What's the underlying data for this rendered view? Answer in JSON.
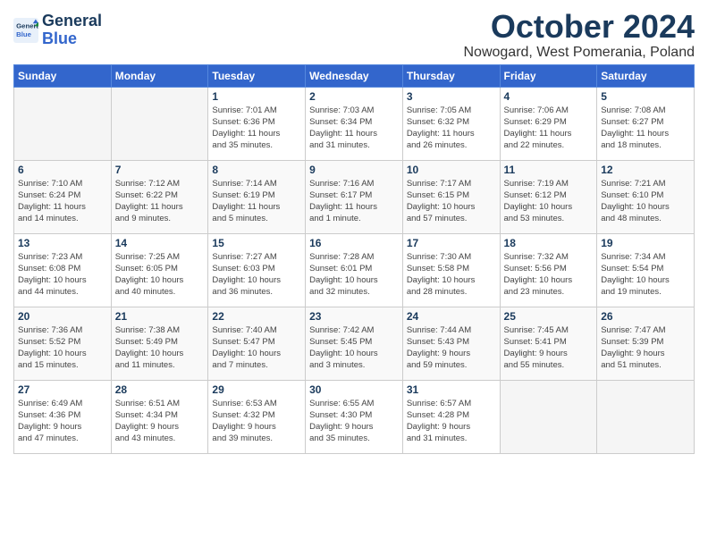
{
  "logo": {
    "line1": "General",
    "line2": "Blue"
  },
  "title": "October 2024",
  "location": "Nowogard, West Pomerania, Poland",
  "days_of_week": [
    "Sunday",
    "Monday",
    "Tuesday",
    "Wednesday",
    "Thursday",
    "Friday",
    "Saturday"
  ],
  "weeks": [
    [
      {
        "day": "",
        "info": ""
      },
      {
        "day": "",
        "info": ""
      },
      {
        "day": "1",
        "info": "Sunrise: 7:01 AM\nSunset: 6:36 PM\nDaylight: 11 hours\nand 35 minutes."
      },
      {
        "day": "2",
        "info": "Sunrise: 7:03 AM\nSunset: 6:34 PM\nDaylight: 11 hours\nand 31 minutes."
      },
      {
        "day": "3",
        "info": "Sunrise: 7:05 AM\nSunset: 6:32 PM\nDaylight: 11 hours\nand 26 minutes."
      },
      {
        "day": "4",
        "info": "Sunrise: 7:06 AM\nSunset: 6:29 PM\nDaylight: 11 hours\nand 22 minutes."
      },
      {
        "day": "5",
        "info": "Sunrise: 7:08 AM\nSunset: 6:27 PM\nDaylight: 11 hours\nand 18 minutes."
      }
    ],
    [
      {
        "day": "6",
        "info": "Sunrise: 7:10 AM\nSunset: 6:24 PM\nDaylight: 11 hours\nand 14 minutes."
      },
      {
        "day": "7",
        "info": "Sunrise: 7:12 AM\nSunset: 6:22 PM\nDaylight: 11 hours\nand 9 minutes."
      },
      {
        "day": "8",
        "info": "Sunrise: 7:14 AM\nSunset: 6:19 PM\nDaylight: 11 hours\nand 5 minutes."
      },
      {
        "day": "9",
        "info": "Sunrise: 7:16 AM\nSunset: 6:17 PM\nDaylight: 11 hours\nand 1 minute."
      },
      {
        "day": "10",
        "info": "Sunrise: 7:17 AM\nSunset: 6:15 PM\nDaylight: 10 hours\nand 57 minutes."
      },
      {
        "day": "11",
        "info": "Sunrise: 7:19 AM\nSunset: 6:12 PM\nDaylight: 10 hours\nand 53 minutes."
      },
      {
        "day": "12",
        "info": "Sunrise: 7:21 AM\nSunset: 6:10 PM\nDaylight: 10 hours\nand 48 minutes."
      }
    ],
    [
      {
        "day": "13",
        "info": "Sunrise: 7:23 AM\nSunset: 6:08 PM\nDaylight: 10 hours\nand 44 minutes."
      },
      {
        "day": "14",
        "info": "Sunrise: 7:25 AM\nSunset: 6:05 PM\nDaylight: 10 hours\nand 40 minutes."
      },
      {
        "day": "15",
        "info": "Sunrise: 7:27 AM\nSunset: 6:03 PM\nDaylight: 10 hours\nand 36 minutes."
      },
      {
        "day": "16",
        "info": "Sunrise: 7:28 AM\nSunset: 6:01 PM\nDaylight: 10 hours\nand 32 minutes."
      },
      {
        "day": "17",
        "info": "Sunrise: 7:30 AM\nSunset: 5:58 PM\nDaylight: 10 hours\nand 28 minutes."
      },
      {
        "day": "18",
        "info": "Sunrise: 7:32 AM\nSunset: 5:56 PM\nDaylight: 10 hours\nand 23 minutes."
      },
      {
        "day": "19",
        "info": "Sunrise: 7:34 AM\nSunset: 5:54 PM\nDaylight: 10 hours\nand 19 minutes."
      }
    ],
    [
      {
        "day": "20",
        "info": "Sunrise: 7:36 AM\nSunset: 5:52 PM\nDaylight: 10 hours\nand 15 minutes."
      },
      {
        "day": "21",
        "info": "Sunrise: 7:38 AM\nSunset: 5:49 PM\nDaylight: 10 hours\nand 11 minutes."
      },
      {
        "day": "22",
        "info": "Sunrise: 7:40 AM\nSunset: 5:47 PM\nDaylight: 10 hours\nand 7 minutes."
      },
      {
        "day": "23",
        "info": "Sunrise: 7:42 AM\nSunset: 5:45 PM\nDaylight: 10 hours\nand 3 minutes."
      },
      {
        "day": "24",
        "info": "Sunrise: 7:44 AM\nSunset: 5:43 PM\nDaylight: 9 hours\nand 59 minutes."
      },
      {
        "day": "25",
        "info": "Sunrise: 7:45 AM\nSunset: 5:41 PM\nDaylight: 9 hours\nand 55 minutes."
      },
      {
        "day": "26",
        "info": "Sunrise: 7:47 AM\nSunset: 5:39 PM\nDaylight: 9 hours\nand 51 minutes."
      }
    ],
    [
      {
        "day": "27",
        "info": "Sunrise: 6:49 AM\nSunset: 4:36 PM\nDaylight: 9 hours\nand 47 minutes."
      },
      {
        "day": "28",
        "info": "Sunrise: 6:51 AM\nSunset: 4:34 PM\nDaylight: 9 hours\nand 43 minutes."
      },
      {
        "day": "29",
        "info": "Sunrise: 6:53 AM\nSunset: 4:32 PM\nDaylight: 9 hours\nand 39 minutes."
      },
      {
        "day": "30",
        "info": "Sunrise: 6:55 AM\nSunset: 4:30 PM\nDaylight: 9 hours\nand 35 minutes."
      },
      {
        "day": "31",
        "info": "Sunrise: 6:57 AM\nSunset: 4:28 PM\nDaylight: 9 hours\nand 31 minutes."
      },
      {
        "day": "",
        "info": ""
      },
      {
        "day": "",
        "info": ""
      }
    ]
  ]
}
